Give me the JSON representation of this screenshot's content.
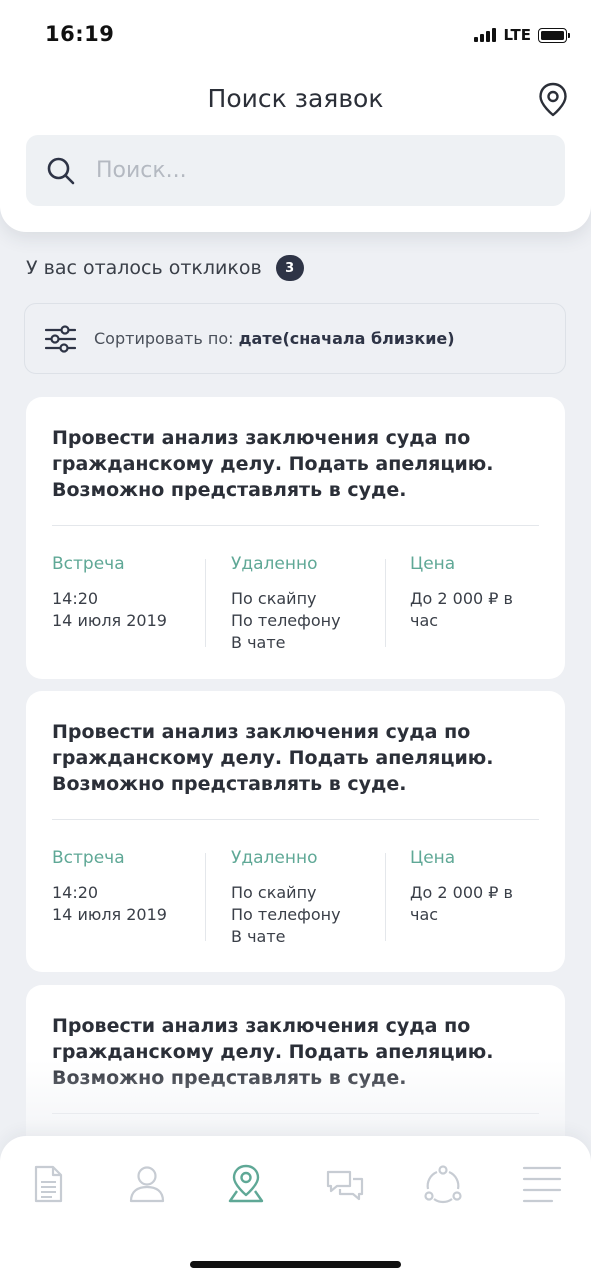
{
  "status_bar": {
    "time": "16:19",
    "network": "LTE"
  },
  "header": {
    "title": "Поиск заявок",
    "location_icon": "map-pin-icon"
  },
  "search": {
    "placeholder": "Поиск...",
    "value": "",
    "icon": "search-icon"
  },
  "responses": {
    "label": "У вас оталось откликов",
    "count": "3"
  },
  "sort": {
    "prefix": "Сортировать по:",
    "value": "дате(сначала близкие)",
    "icon": "filter-sliders-icon"
  },
  "colors": {
    "accent": "#5fa896",
    "dark": "#2e3446",
    "background": "#eef0f4"
  },
  "cards": [
    {
      "title": "Провести анализ заключения суда по гражданскому делу. Подать апеляцию. Возможно представлять в суде.",
      "meeting_label": "Встреча",
      "meeting_time": "14:20",
      "meeting_date": "14 июля 2019",
      "remote_label": "Удаленно",
      "remote_1": "По скайпу",
      "remote_2": "По телефону",
      "remote_3": "В чате",
      "price_label": "Цена",
      "price_line_1": "До 2 000 ₽ в",
      "price_line_2": "час"
    },
    {
      "title": "Провести анализ заключения суда по гражданскому делу. Подать апеляцию. Возможно представлять в суде.",
      "meeting_label": "Встреча",
      "meeting_time": "14:20",
      "meeting_date": "14 июля 2019",
      "remote_label": "Удаленно",
      "remote_1": "По скайпу",
      "remote_2": "По телефону",
      "remote_3": "В чате",
      "price_label": "Цена",
      "price_line_1": "До 2 000 ₽ в",
      "price_line_2": "час"
    },
    {
      "title": "Провести анализ заключения суда по гражданскому делу. Подать апеляцию. Возможно представлять в суде."
    }
  ],
  "tabs": [
    {
      "icon": "document-icon",
      "active": false
    },
    {
      "icon": "profile-icon",
      "active": false
    },
    {
      "icon": "map-search-icon",
      "active": true
    },
    {
      "icon": "chat-icon",
      "active": false
    },
    {
      "icon": "network-icon",
      "active": false
    },
    {
      "icon": "menu-icon",
      "active": false
    }
  ]
}
